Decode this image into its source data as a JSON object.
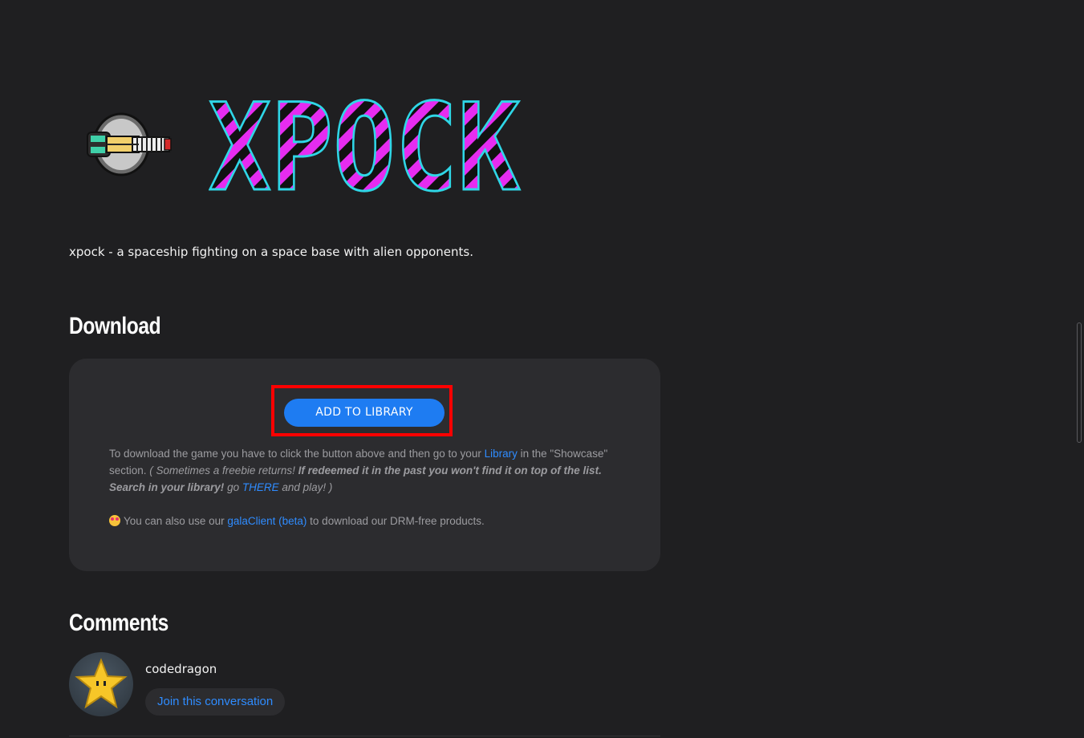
{
  "game": {
    "logo_text": "XPOCK",
    "description": "xpock - a spaceship fighting on a space base with alien opponents."
  },
  "download": {
    "title": "Download",
    "button_label": "ADD TO LIBRARY",
    "info": {
      "p1_text1": "To download the game you have to click the button above and then go to your ",
      "library_link": "Library",
      "p1_text2": " in the \"Showcase\" section. ",
      "italic1": "( Sometimes a freebie returns! ",
      "bold_italic": "If redeemed it in the past you won't find it on top of the list. Search in your library!",
      "italic2": " go ",
      "there_link": "THERE",
      "italic3": " and play! )",
      "p2_text1": "You can also use our ",
      "client_link": "galaClient (beta)",
      "p2_text2": " to download our DRM-free products."
    }
  },
  "comments": {
    "title": "Comments",
    "user": "codedragon",
    "join_label": "Join this conversation"
  },
  "colors": {
    "background": "#1f1f21",
    "card": "#2c2c2f",
    "accent": "#1e7cf2",
    "link": "#2f8cff",
    "highlight": "#ff0000",
    "logo_magenta": "#e62cf0",
    "logo_cyan": "#2fd6e6"
  }
}
